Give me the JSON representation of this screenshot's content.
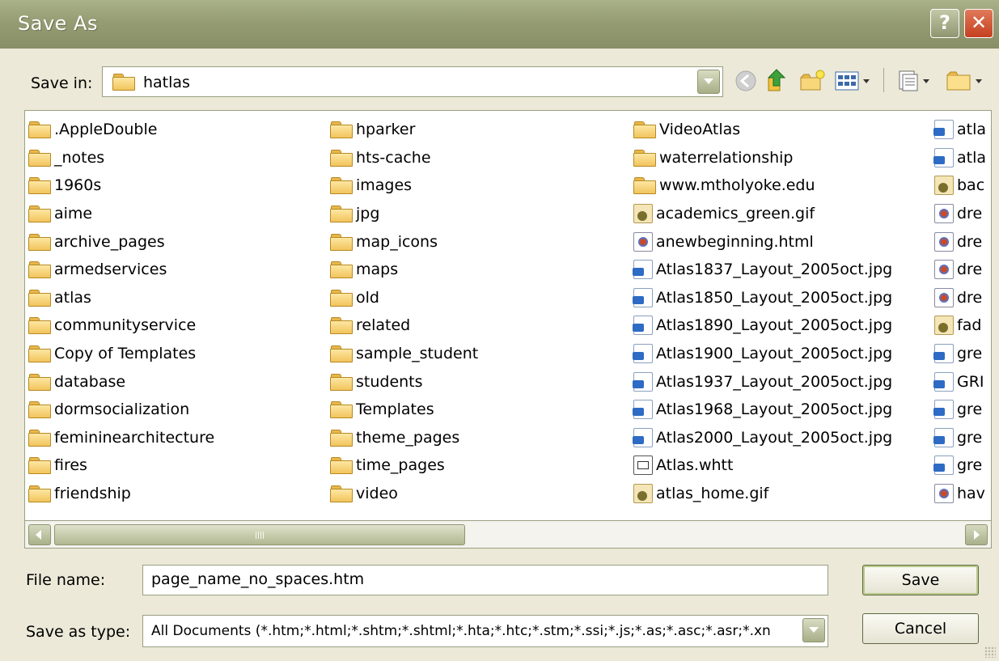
{
  "window": {
    "title": "Save As",
    "help_label": "?",
    "close_label": "✕"
  },
  "save_in": {
    "label": "Save in:",
    "value": "hatlas",
    "toolbar_icons": [
      "back-icon",
      "up-one-level-icon",
      "create-new-folder-icon",
      "view-menu-icon",
      "tools-menu-icon",
      "folder-menu-icon"
    ]
  },
  "file_list": {
    "columns": [
      [
        {
          "name": ".AppleDouble",
          "icon": "folder-icon"
        },
        {
          "name": "_notes",
          "icon": "folder-icon"
        },
        {
          "name": "1960s",
          "icon": "folder-icon"
        },
        {
          "name": "aime",
          "icon": "folder-icon"
        },
        {
          "name": "archive_pages",
          "icon": "folder-icon"
        },
        {
          "name": "armedservices",
          "icon": "folder-icon"
        },
        {
          "name": "atlas",
          "icon": "folder-icon"
        },
        {
          "name": "communityservice",
          "icon": "folder-icon"
        },
        {
          "name": "Copy of Templates",
          "icon": "folder-icon"
        },
        {
          "name": "database",
          "icon": "folder-icon"
        },
        {
          "name": "dormsocialization",
          "icon": "folder-icon"
        },
        {
          "name": "femininearchitecture",
          "icon": "folder-icon"
        },
        {
          "name": "fires",
          "icon": "folder-icon"
        },
        {
          "name": "friendship",
          "icon": "folder-icon"
        }
      ],
      [
        {
          "name": "hparker",
          "icon": "folder-icon"
        },
        {
          "name": "hts-cache",
          "icon": "folder-icon"
        },
        {
          "name": "images",
          "icon": "folder-icon"
        },
        {
          "name": "jpg",
          "icon": "folder-icon"
        },
        {
          "name": "map_icons",
          "icon": "folder-icon"
        },
        {
          "name": "maps",
          "icon": "folder-icon"
        },
        {
          "name": "old",
          "icon": "folder-icon"
        },
        {
          "name": "related",
          "icon": "folder-icon"
        },
        {
          "name": "sample_student",
          "icon": "folder-icon"
        },
        {
          "name": "students",
          "icon": "folder-icon"
        },
        {
          "name": "Templates",
          "icon": "folder-icon"
        },
        {
          "name": "theme_pages",
          "icon": "folder-icon"
        },
        {
          "name": "time_pages",
          "icon": "folder-icon"
        },
        {
          "name": "video",
          "icon": "folder-icon"
        }
      ],
      [
        {
          "name": "VideoAtlas",
          "icon": "folder-icon"
        },
        {
          "name": "waterrelationship",
          "icon": "folder-icon"
        },
        {
          "name": "www.mtholyoke.edu",
          "icon": "folder-icon"
        },
        {
          "name": "academics_green.gif",
          "icon": "gif-file-icon"
        },
        {
          "name": "anewbeginning.html",
          "icon": "html-file-icon"
        },
        {
          "name": "Atlas1837_Layout_2005oct.jpg",
          "icon": "jpg-file-icon"
        },
        {
          "name": "Atlas1850_Layout_2005oct.jpg",
          "icon": "jpg-file-icon"
        },
        {
          "name": "Atlas1890_Layout_2005oct.jpg",
          "icon": "jpg-file-icon"
        },
        {
          "name": "Atlas1900_Layout_2005oct.jpg",
          "icon": "jpg-file-icon"
        },
        {
          "name": "Atlas1937_Layout_2005oct.jpg",
          "icon": "jpg-file-icon"
        },
        {
          "name": "Atlas1968_Layout_2005oct.jpg",
          "icon": "jpg-file-icon"
        },
        {
          "name": "Atlas2000_Layout_2005oct.jpg",
          "icon": "jpg-file-icon"
        },
        {
          "name": "Atlas.whtt",
          "icon": "whtt-file-icon"
        },
        {
          "name": "atlas_home.gif",
          "icon": "gif-file-icon"
        }
      ],
      [
        {
          "name": "atla",
          "icon": "jpg-file-icon"
        },
        {
          "name": "atla",
          "icon": "jpg-file-icon"
        },
        {
          "name": "bac",
          "icon": "gif-file-icon"
        },
        {
          "name": "dre",
          "icon": "html-file-icon"
        },
        {
          "name": "dre",
          "icon": "html-file-icon"
        },
        {
          "name": "dre",
          "icon": "html-file-icon"
        },
        {
          "name": "dre",
          "icon": "html-file-icon"
        },
        {
          "name": "fad",
          "icon": "gif-file-icon"
        },
        {
          "name": "gre",
          "icon": "jpg-file-icon"
        },
        {
          "name": "GRI",
          "icon": "jpg-file-icon"
        },
        {
          "name": "gre",
          "icon": "jpg-file-icon"
        },
        {
          "name": "gre",
          "icon": "jpg-file-icon"
        },
        {
          "name": "gre",
          "icon": "jpg-file-icon"
        },
        {
          "name": "hav",
          "icon": "html-file-icon"
        }
      ]
    ]
  },
  "file_name": {
    "label": "File name:",
    "value": "page_name_no_spaces.htm"
  },
  "save_as_type": {
    "label": "Save as type:",
    "value": "All Documents (*.htm;*.html;*.shtm;*.shtml;*.hta;*.htc;*.stm;*.ssi;*.js;*.as;*.asc;*.asr;*.xn"
  },
  "buttons": {
    "save": "Save",
    "cancel": "Cancel"
  }
}
